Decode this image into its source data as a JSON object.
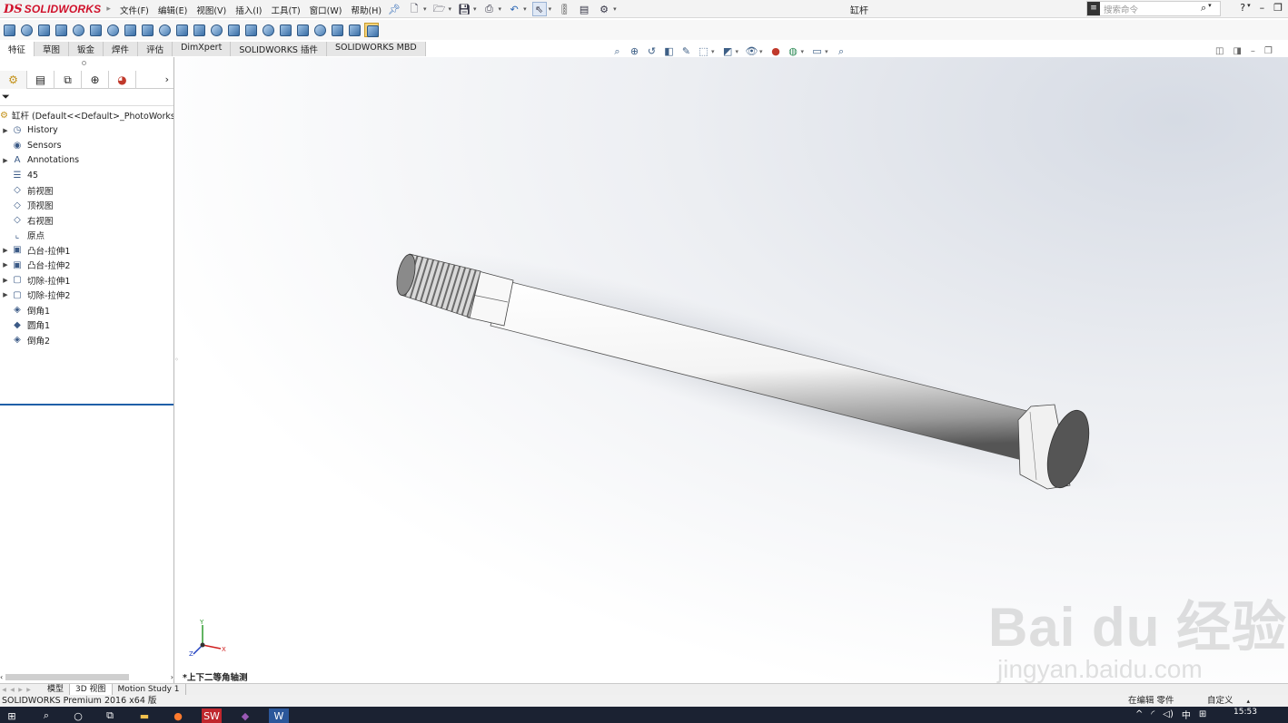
{
  "app": {
    "brand_ds": "DS",
    "brand_name": "SOLIDWORKS",
    "window_title": "缸杆",
    "search_placeholder": "搜索命令"
  },
  "menu": [
    "文件(F)",
    "编辑(E)",
    "视图(V)",
    "插入(I)",
    "工具(T)",
    "窗口(W)",
    "帮助(H)"
  ],
  "tabs": [
    "特征",
    "草图",
    "钣金",
    "焊件",
    "评估",
    "DimXpert",
    "SOLIDWORKS 插件",
    "SOLIDWORKS MBD"
  ],
  "active_tab": 0,
  "tree": {
    "root_label": "缸杆  (Default<<Default>_PhotoWorks D",
    "items": [
      {
        "label": "History",
        "icon": "history-icon",
        "expandable": true
      },
      {
        "label": "Sensors",
        "icon": "sensors-icon",
        "expandable": false
      },
      {
        "label": "Annotations",
        "icon": "annotations-icon",
        "expandable": true
      },
      {
        "label": "45",
        "icon": "material-icon",
        "expandable": false
      },
      {
        "label": "前视图",
        "icon": "plane-icon",
        "expandable": false
      },
      {
        "label": "顶视图",
        "icon": "plane-icon",
        "expandable": false
      },
      {
        "label": "右视图",
        "icon": "plane-icon",
        "expandable": false
      },
      {
        "label": "原点",
        "icon": "origin-icon",
        "expandable": false
      },
      {
        "label": "凸台-拉伸1",
        "icon": "extrude-boss-icon",
        "expandable": true
      },
      {
        "label": "凸台-拉伸2",
        "icon": "extrude-boss-icon",
        "expandable": true
      },
      {
        "label": "切除-拉伸1",
        "icon": "extrude-cut-icon",
        "expandable": true
      },
      {
        "label": "切除-拉伸2",
        "icon": "extrude-cut-icon",
        "expandable": true
      },
      {
        "label": "倒角1",
        "icon": "chamfer-icon",
        "expandable": false
      },
      {
        "label": "圆角1",
        "icon": "fillet-icon",
        "expandable": false
      },
      {
        "label": "倒角2",
        "icon": "chamfer-icon",
        "expandable": false
      }
    ]
  },
  "viewport": {
    "view_name": "*上下二等角轴测",
    "axis_labels": {
      "x": "X",
      "y": "Y",
      "z": "Z"
    },
    "watermark_main": "Bai du 经验",
    "watermark_sub": "jingyan.baidu.com"
  },
  "bottom_tabs": [
    "模型",
    "3D 视图",
    "Motion Study 1"
  ],
  "status": {
    "left": "SOLIDWORKS Premium 2016 x64 版",
    "mode": "在编辑 零件",
    "custom": "自定义"
  },
  "taskbar": {
    "tray_lang": "中",
    "clock": "15:53"
  }
}
